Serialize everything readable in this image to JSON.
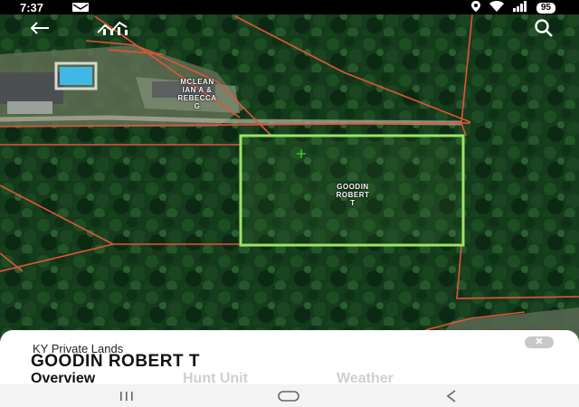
{
  "status_bar": {
    "time": "7:37",
    "battery": "95"
  },
  "parcels": {
    "neighbor_label": "MCLEAN IAN A & REBECCA G",
    "neighbor_lines": [
      "MCLEAN",
      "IAN A &",
      "REBECCA",
      "G"
    ],
    "selected_label": "GOODIN ROBERT T",
    "selected_lines": [
      "GOODIN",
      "ROBERT",
      "T"
    ]
  },
  "colors": {
    "selected_boundary": "#9be564",
    "parcel_boundary": "#e0553a"
  },
  "sheet": {
    "subtitle": "KY Private Lands",
    "title": "GOODIN ROBERT T",
    "tabs": [
      {
        "label": "Overview",
        "active": true
      },
      {
        "label": "Hunt Unit",
        "active": false
      },
      {
        "label": "Weather",
        "active": false
      }
    ]
  },
  "icons": [
    "back-arrow-icon",
    "stats-chart-icon",
    "search-icon",
    "close-icon",
    "recents-icon",
    "home-icon",
    "nav-back-icon",
    "mail-icon",
    "location-icon",
    "wifi-icon",
    "signal-icon"
  ]
}
